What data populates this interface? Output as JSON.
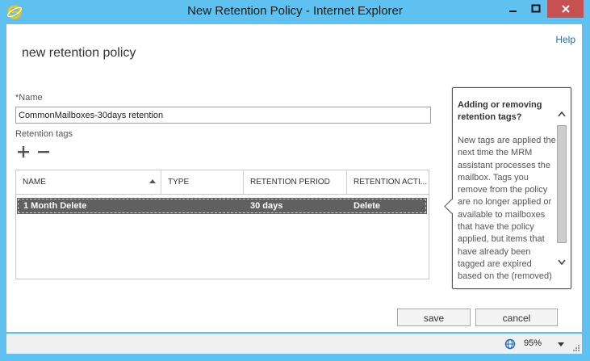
{
  "window": {
    "title": "New Retention Policy - Internet Explorer"
  },
  "page": {
    "help": "Help",
    "heading": "new retention policy"
  },
  "form": {
    "name_label": "*Name",
    "name_value": "CommonMailboxes-30days retention",
    "tags_label": "Retention tags"
  },
  "table": {
    "columns": [
      "NAME",
      "TYPE",
      "RETENTION PERIOD",
      "RETENTION ACTI..."
    ],
    "rows": [
      {
        "name": "1 Month Delete",
        "type": "",
        "period": "30 days",
        "action": "Delete"
      }
    ]
  },
  "callout": {
    "title": "Adding or removing retention tags?",
    "body": "New tags are applied the next time the MRM assistant processes the mailbox. Tags you remove from the policy are no longer applied or available to mailboxes that have the policy applied, but items that have already been tagged are expired based on the (removed)"
  },
  "buttons": {
    "save": "save",
    "cancel": "cancel"
  },
  "status": {
    "zoom": "95%"
  },
  "colors": {
    "titlebar": "#5fc1ef",
    "close": "#c75050",
    "selected_row": "#606060",
    "link": "#1e6fb8"
  }
}
